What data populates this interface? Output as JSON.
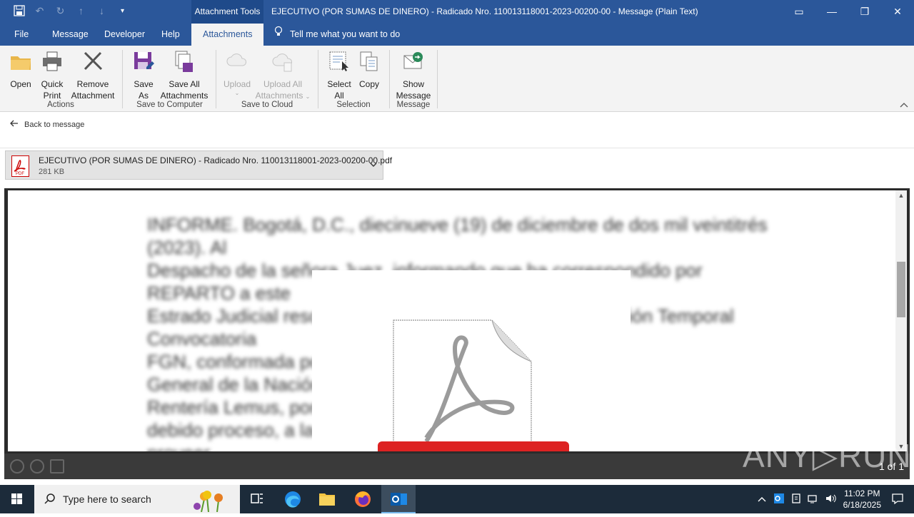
{
  "titlebar": {
    "context_tab": "Attachment Tools",
    "title": "EJECUTIVO (POR SUMAS DE DINERO) - Radicado Nro. 110013118001-2023-00200-00  -  Message (Plain Text)"
  },
  "tabs": {
    "file": "File",
    "message": "Message",
    "developer": "Developer",
    "help": "Help",
    "attachments": "Attachments",
    "tellme": "Tell me what you want to do"
  },
  "ribbon": {
    "open": "Open",
    "quick_print": [
      "Quick",
      "Print"
    ],
    "remove_attachment": [
      "Remove",
      "Attachment"
    ],
    "group_actions": "Actions",
    "save_as": [
      "Save",
      "As"
    ],
    "save_all": [
      "Save All",
      "Attachments"
    ],
    "group_save_computer": "Save to Computer",
    "upload": "Upload",
    "upload_all": [
      "Upload All",
      "Attachments"
    ],
    "group_save_cloud": "Save to Cloud",
    "select_all": [
      "Select",
      "All"
    ],
    "copy": "Copy",
    "group_selection": "Selection",
    "show_message": [
      "Show",
      "Message"
    ],
    "group_message": "Message"
  },
  "back_link": "Back to message",
  "attachment": {
    "filename": "EJECUTIVO (POR SUMAS DE DINERO) - Radicado Nro. 110013118001-2023-00200-00.pdf",
    "size": "281 KB"
  },
  "preview": {
    "lines": [
      "INFORME. Bogotá, D.C., diecinueve (19) de diciembre de dos mil veintitrés (2023). Al",
      "Despacho de la señora Juez, informando que ha correspondido por REPARTO a este",
      "Estrado Judicial resolver la solicitud de Tutela contra la Unión Temporal Convocatoria",
      "FGN, conformada por                                              S.A.S., y la Fiscalía",
      "General de la Nación                                             dadana Ruby Lorena",
      "Rentería Lemus, por                                             tales a la igualdad,",
      "debido proceso, a la pr                                         os públicos. Sírvase",
      "proveer."
    ],
    "page_count": "1 of 1"
  },
  "watermark": "ANY▷RUN",
  "taskbar": {
    "search_placeholder": "Type here to search",
    "time": "11:02 PM",
    "date": "6/18/2025"
  }
}
